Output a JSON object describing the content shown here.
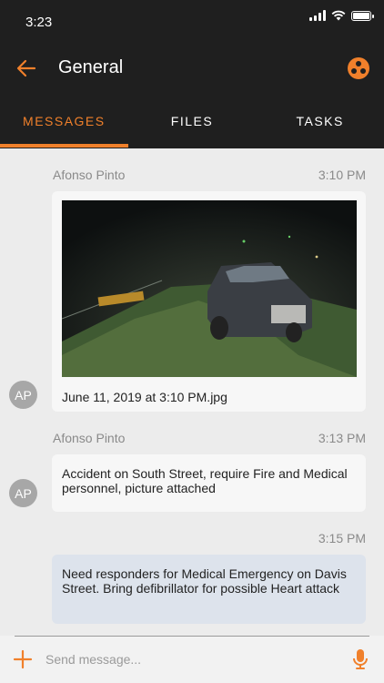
{
  "status_bar": {
    "time": "3:23"
  },
  "header": {
    "title": "General"
  },
  "tabs": [
    {
      "label": "MESSAGES",
      "active": true
    },
    {
      "label": "FILES",
      "active": false
    },
    {
      "label": "TASKS",
      "active": false
    }
  ],
  "messages": [
    {
      "sender": "Afonso Pinto",
      "time": "3:10 PM",
      "avatar": "AP",
      "attachment": "June 11, 2019 at 3:10 PM.jpg"
    },
    {
      "sender": "Afonso Pinto",
      "time": "3:13 PM",
      "avatar": "AP",
      "text": "Accident on South Street, require Fire and Medical personnel, picture attached"
    },
    {
      "time": "3:15 PM",
      "text": "Need responders for Medical Emergency on Davis Street.  Bring defibrillator for possible Heart attack"
    }
  ],
  "composer": {
    "placeholder": "Send message..."
  },
  "colors": {
    "accent": "#f0802b",
    "header_bg": "#1f1f1f",
    "own_bubble": "#dde3ec"
  }
}
